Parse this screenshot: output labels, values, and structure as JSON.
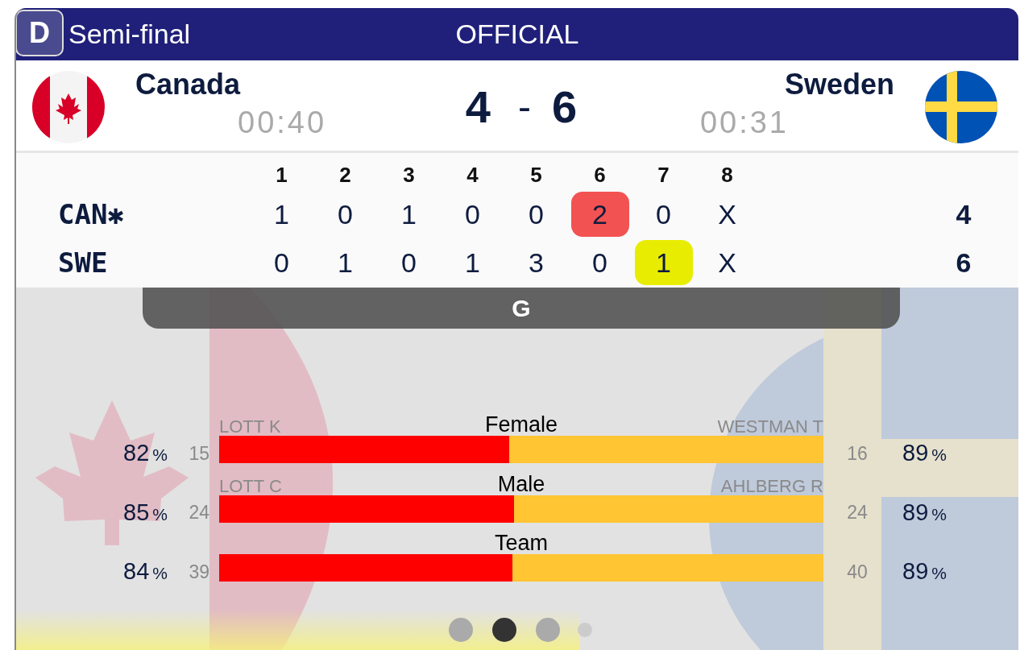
{
  "header": {
    "badge": "D",
    "round": "Semi-final",
    "status": "OFFICIAL"
  },
  "home": {
    "name": "Canada",
    "time": "00:40",
    "score": "4"
  },
  "separator": "-",
  "away": {
    "name": "Sweden",
    "time": "00:31",
    "score": "6"
  },
  "linescore": {
    "ends": [
      "1",
      "2",
      "3",
      "4",
      "5",
      "6",
      "7",
      "8"
    ],
    "rows": [
      {
        "team": "CAN✱",
        "cells": [
          {
            "value": "1"
          },
          {
            "value": "0"
          },
          {
            "value": "1"
          },
          {
            "value": "0"
          },
          {
            "value": "0"
          },
          {
            "value": "2",
            "color": "#f25252"
          },
          {
            "value": "0"
          },
          {
            "value": "X"
          }
        ],
        "total": "4"
      },
      {
        "team": "SWE",
        "cells": [
          {
            "value": "0"
          },
          {
            "value": "1"
          },
          {
            "value": "0"
          },
          {
            "value": "1"
          },
          {
            "value": "3"
          },
          {
            "value": "0"
          },
          {
            "value": "1",
            "color": "#e8ec00"
          },
          {
            "value": "X"
          }
        ],
        "total": "6"
      }
    ]
  },
  "banner": "G",
  "stats": [
    {
      "category": "Female",
      "left_player": "LOTT K",
      "right_player": "WESTMAN T",
      "left_pct": "82",
      "left_count": "15",
      "right_count": "16",
      "right_pct": "89",
      "level": 0.48
    },
    {
      "category": "Male",
      "left_player": "LOTT C",
      "right_player": "AHLBERG R",
      "left_pct": "85",
      "left_count": "24",
      "right_count": "24",
      "right_pct": "89",
      "level": 0.488
    },
    {
      "category": "Team",
      "left_pct": "84",
      "left_count": "39",
      "right_count": "40",
      "right_pct": "89",
      "level": 0.485
    }
  ],
  "pct_unit": "%",
  "pager": [
    {
      "selected": false,
      "kind": "page"
    },
    {
      "selected": true,
      "kind": "page"
    },
    {
      "selected": false,
      "kind": "page"
    },
    {
      "selected": false,
      "kind": "more"
    }
  ]
}
